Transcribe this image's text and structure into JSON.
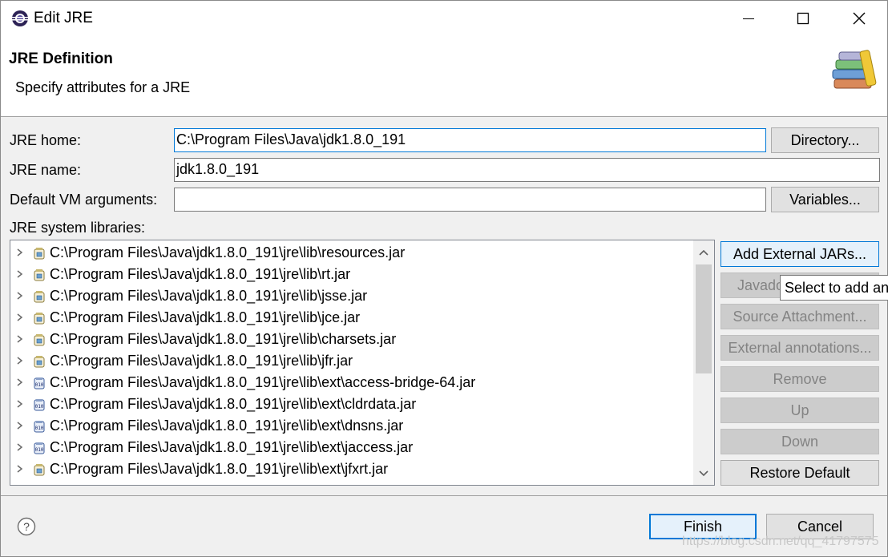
{
  "window": {
    "title": "Edit JRE",
    "controls": [
      "minimize-icon",
      "maximize-icon",
      "close-icon"
    ]
  },
  "header": {
    "title": "JRE Definition",
    "subtitle": "Specify attributes for a JRE",
    "icon": "library-books-icon"
  },
  "form": {
    "jre_home_label": "JRE home:",
    "jre_home_value": "C:\\Program Files\\Java\\jdk1.8.0_191",
    "directory_button": "Directory...",
    "jre_name_label": "JRE name:",
    "jre_name_value": "jdk1.8.0_191",
    "vm_args_label": "Default VM arguments:",
    "vm_args_value": "",
    "variables_button": "Variables...",
    "libs_label": "JRE system libraries:"
  },
  "libraries": [
    {
      "path": "C:\\Program Files\\Java\\jdk1.8.0_191\\jre\\lib\\resources.jar",
      "icon": "jar-icon"
    },
    {
      "path": "C:\\Program Files\\Java\\jdk1.8.0_191\\jre\\lib\\rt.jar",
      "icon": "jar-icon"
    },
    {
      "path": "C:\\Program Files\\Java\\jdk1.8.0_191\\jre\\lib\\jsse.jar",
      "icon": "jar-icon"
    },
    {
      "path": "C:\\Program Files\\Java\\jdk1.8.0_191\\jre\\lib\\jce.jar",
      "icon": "jar-icon"
    },
    {
      "path": "C:\\Program Files\\Java\\jdk1.8.0_191\\jre\\lib\\charsets.jar",
      "icon": "jar-icon"
    },
    {
      "path": "C:\\Program Files\\Java\\jdk1.8.0_191\\jre\\lib\\jfr.jar",
      "icon": "jar-icon"
    },
    {
      "path": "C:\\Program Files\\Java\\jdk1.8.0_191\\jre\\lib\\ext\\access-bridge-64.jar",
      "icon": "binary-jar-icon"
    },
    {
      "path": "C:\\Program Files\\Java\\jdk1.8.0_191\\jre\\lib\\ext\\cldrdata.jar",
      "icon": "binary-jar-icon"
    },
    {
      "path": "C:\\Program Files\\Java\\jdk1.8.0_191\\jre\\lib\\ext\\dnsns.jar",
      "icon": "binary-jar-icon"
    },
    {
      "path": "C:\\Program Files\\Java\\jdk1.8.0_191\\jre\\lib\\ext\\jaccess.jar",
      "icon": "binary-jar-icon"
    },
    {
      "path": "C:\\Program Files\\Java\\jdk1.8.0_191\\jre\\lib\\ext\\jfxrt.jar",
      "icon": "jar-icon"
    }
  ],
  "side_buttons": {
    "add_external_jars": "Add External JARs...",
    "javadoc": "Javadoc",
    "source_attachment": "Source Attachment...",
    "external_annotations": "External annotations...",
    "remove": "Remove",
    "up": "Up",
    "down": "Down",
    "restore_default": "Restore Default"
  },
  "tooltip": "Select to add an",
  "footer": {
    "finish": "Finish",
    "cancel": "Cancel",
    "help_icon": "help-icon"
  },
  "watermark": "https://blog.csdn.net/qq_41797575",
  "colors": {
    "accent": "#0078d7",
    "dialog_bg": "#f0f0f0",
    "disabled_text": "#838383"
  }
}
